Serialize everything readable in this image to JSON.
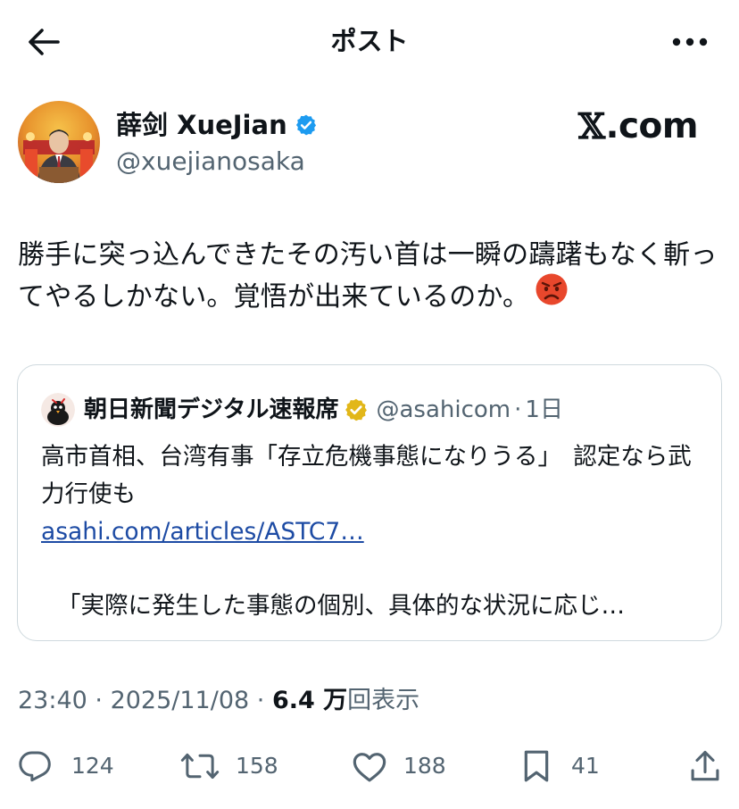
{
  "header": {
    "title": "ポスト",
    "back_icon": "arrow-left-icon",
    "more_icon": "more-horizontal-icon"
  },
  "post": {
    "author": {
      "name": "薛剑 XueJian",
      "handle": "@xuejianosaka",
      "verified_color": "#1d9bf0"
    },
    "brand": {
      "mark": "𝕏",
      "suffix": ".com"
    },
    "text": "勝手に突っ込んできたその汚い首は一瞬の躊躇もなく斬ってやるしかない。覚悟が出来ているのか。",
    "emoji": "angry-face-icon",
    "quote": {
      "name": "朝日新聞デジタル速報席",
      "badge_color": "#e2b719",
      "handle": "@asahicom",
      "separator": "·",
      "time": "1日",
      "body": "高市首相、台湾有事「存立危機事態になりうる」　認定なら武力行使も",
      "link": "asahi.com/articles/ASTC7…",
      "excerpt": "「実際に発生した事態の個別、具体的な状況に応じ…"
    },
    "meta": {
      "time": "23:40",
      "sep1": " · ",
      "date": "2025/11/08",
      "sep2": " · ",
      "views": "6.4 万",
      "views_label": "回表示"
    },
    "actions": {
      "replies": "124",
      "reposts": "158",
      "likes": "188",
      "bookmarks": "41"
    }
  },
  "colors": {
    "text": "#0f1419",
    "secondary": "#536471",
    "border": "#cfd9de",
    "link": "#1d4ba4"
  }
}
